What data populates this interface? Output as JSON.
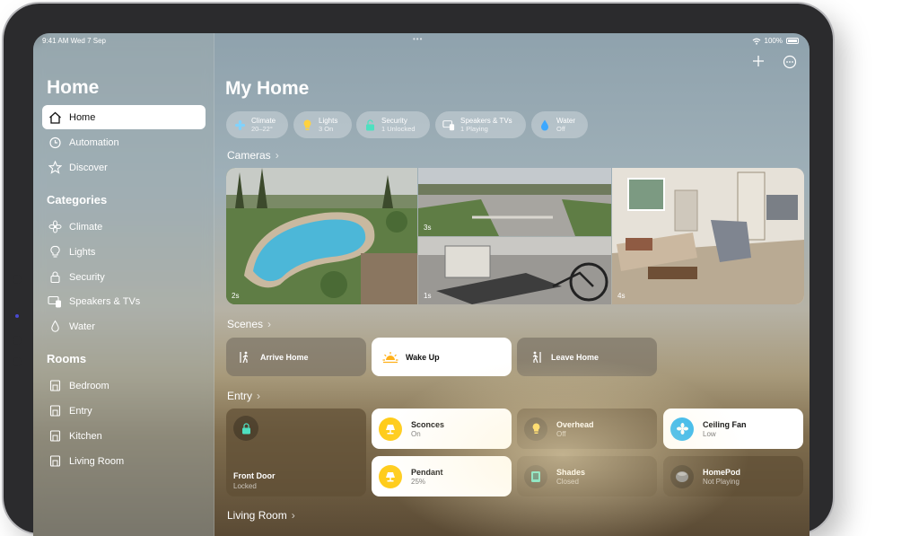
{
  "status_bar": {
    "time": "9:41 AM  Wed 7 Sep",
    "dots": "•••",
    "battery": "100%"
  },
  "sidebar": {
    "title": "Home",
    "items": [
      {
        "label": "Home",
        "icon": "house-icon",
        "active": true
      },
      {
        "label": "Automation",
        "icon": "clock-icon"
      },
      {
        "label": "Discover",
        "icon": "star-icon"
      }
    ],
    "categories_label": "Categories",
    "categories": [
      {
        "label": "Climate",
        "icon": "fan-icon"
      },
      {
        "label": "Lights",
        "icon": "lightbulb-icon"
      },
      {
        "label": "Security",
        "icon": "lock-icon"
      },
      {
        "label": "Speakers & TVs",
        "icon": "tv-icon"
      },
      {
        "label": "Water",
        "icon": "drop-icon"
      }
    ],
    "rooms_label": "Rooms",
    "rooms": [
      {
        "label": "Bedroom",
        "icon": "room-icon"
      },
      {
        "label": "Entry",
        "icon": "room-icon"
      },
      {
        "label": "Kitchen",
        "icon": "room-icon"
      },
      {
        "label": "Living Room",
        "icon": "room-icon"
      }
    ]
  },
  "main": {
    "title": "My Home",
    "pills": [
      {
        "title": "Climate",
        "subtitle": "20–22°",
        "icon": "fan-icon",
        "color": "#7fd3ff"
      },
      {
        "title": "Lights",
        "subtitle": "3 On",
        "icon": "lightbulb-icon",
        "color": "#ffd23f"
      },
      {
        "title": "Security",
        "subtitle": "1 Unlocked",
        "icon": "lock-icon",
        "color": "#4ee0c0"
      },
      {
        "title": "Speakers & TVs",
        "subtitle": "1 Playing",
        "icon": "tv-icon",
        "color": "#ffffff"
      },
      {
        "title": "Water",
        "subtitle": "Off",
        "icon": "drop-icon",
        "color": "#3da8ff"
      }
    ],
    "cameras_label": "Cameras",
    "cameras": [
      {
        "label": "2s",
        "scene": "pool"
      },
      {
        "label": "3s",
        "scene": "driveway"
      },
      {
        "label": "1s",
        "scene": "garage"
      },
      {
        "label": "4s",
        "scene": "living-room"
      }
    ],
    "scenes_label": "Scenes",
    "scenes": [
      {
        "label": "Arrive Home",
        "icon": "walk-in-icon",
        "style": "dark"
      },
      {
        "label": "Wake Up",
        "icon": "sunrise-icon",
        "style": "light"
      },
      {
        "label": "Leave Home",
        "icon": "walk-out-icon",
        "style": "dark"
      }
    ],
    "entry_label": "Entry",
    "front_door": {
      "name": "Front Door",
      "status": "Locked",
      "icon": "lock-icon"
    },
    "accessories": [
      {
        "name": "Sconces",
        "status": "On",
        "icon": "lamp-icon",
        "style": "light",
        "circle": "#ffcc1a"
      },
      {
        "name": "Overhead",
        "status": "Off",
        "icon": "lightbulb-icon",
        "style": "dark",
        "circle": "rgba(0,0,0,0.25)"
      },
      {
        "name": "Ceiling Fan",
        "status": "Low",
        "icon": "fan-icon",
        "style": "light",
        "circle": "#2fb6ef"
      },
      {
        "name": "Pendant",
        "status": "25%",
        "icon": "lamp-icon",
        "style": "light",
        "circle": "#ffcc1a"
      },
      {
        "name": "Shades",
        "status": "Closed",
        "icon": "shades-icon",
        "style": "dark",
        "circle": "rgba(0,0,0,0.25)"
      },
      {
        "name": "HomePod",
        "status": "Not Playing",
        "icon": "homepod-icon",
        "style": "dark",
        "circle": "rgba(0,0,0,0.25)"
      }
    ],
    "living_room_label": "Living Room"
  }
}
